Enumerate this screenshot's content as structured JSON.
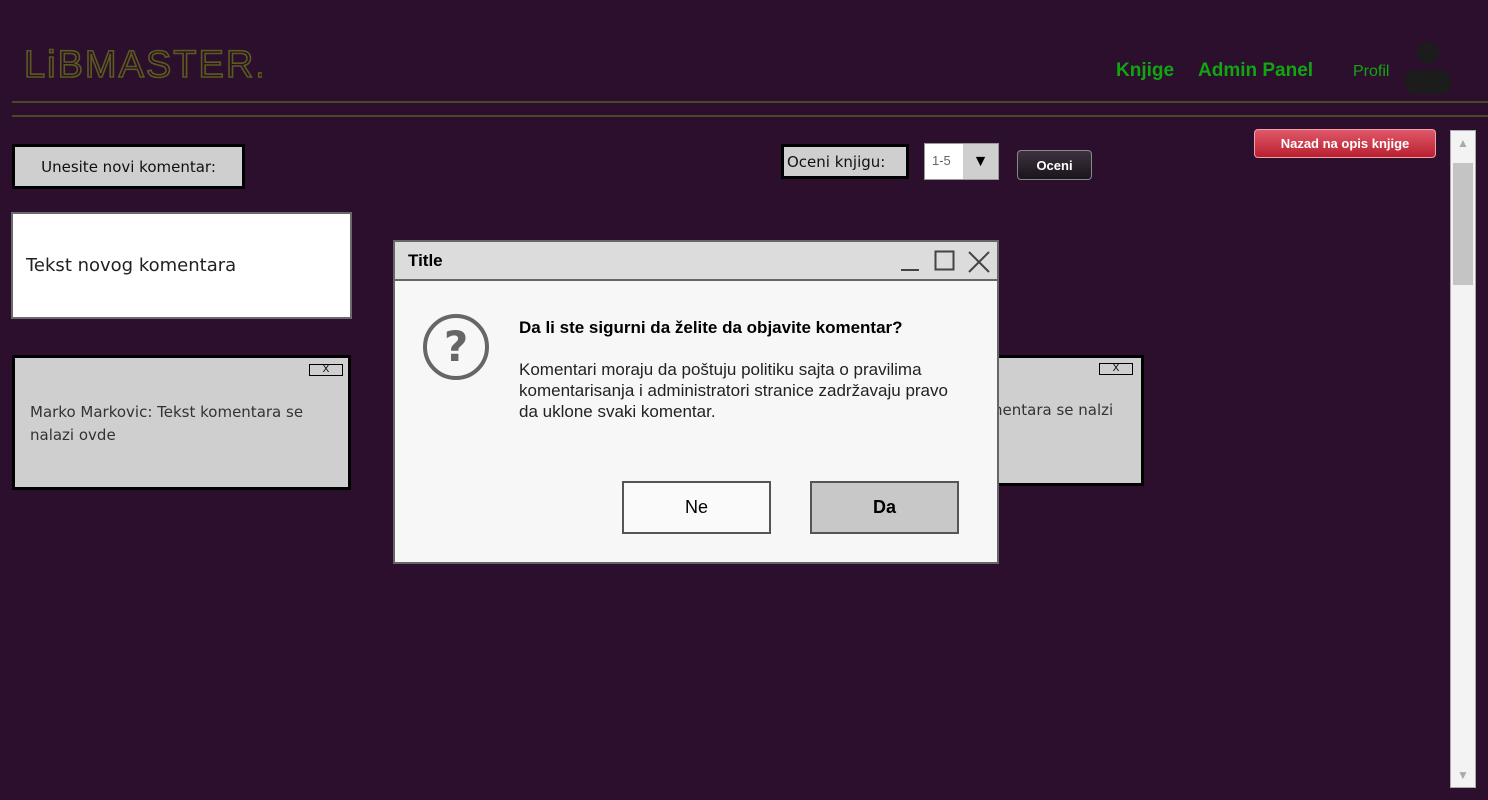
{
  "app": {
    "logo_text": "LiBMASTER."
  },
  "nav": {
    "knjige": "Knjige",
    "admin_panel": "Admin Panel",
    "profil": "Profil"
  },
  "comments": {
    "new_label": "Unesite novi komentar:",
    "input_placeholder": "Tekst novog komentara",
    "items": [
      {
        "text": "Marko Markovic: Tekst komentara se nalazi ovde",
        "close": "X"
      },
      {
        "text": "nentara se nalzi",
        "close": "X"
      }
    ]
  },
  "rating": {
    "label": "Oceni knjigu:",
    "select_value": "1-5",
    "submit_label": "Oceni"
  },
  "back_button": "Nazad na opis knjige",
  "dialog": {
    "title": "Title",
    "heading": "Da li ste sigurni da želite da objavite komentar?",
    "body": "Komentari moraju da poštuju politiku sajta o pravilima komentarisanja i administratori stranice zadržavaju pravo da uklone svaki komentar.",
    "cancel_label": "Ne",
    "confirm_label": "Da"
  },
  "colors": {
    "background": "#2b0f2c",
    "nav_link": "#12a512",
    "logo": "#5b5b1e",
    "back_button": "#c8303f"
  }
}
